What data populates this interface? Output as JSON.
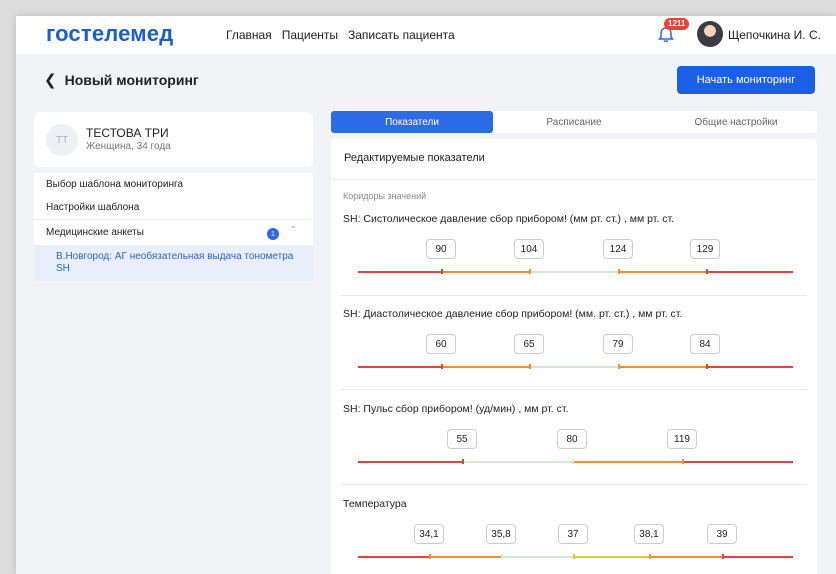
{
  "header": {
    "logo": "гостелемед",
    "nav": [
      "Главная",
      "Пациенты",
      "Записать пациента"
    ],
    "notification_count": "1211",
    "user_name": "Щепочкина И. С."
  },
  "page": {
    "title": "Новый мониторинг",
    "start_button": "Начать мониторинг"
  },
  "patient": {
    "initials": "ТТ",
    "name": "ТЕСТОВА ТРИ",
    "subtitle": "Женщина, 34 года"
  },
  "menu": {
    "items": [
      "Выбор шаблона мониторинга",
      "Настройки шаблона",
      "Медицинские анкеты"
    ],
    "questionnaire_count": "1",
    "selected_subitem": "В.Новгород: АГ необязательная выдача тонометра SH"
  },
  "tabs": [
    "Показатели",
    "Расписание",
    "Общие настройки"
  ],
  "content": {
    "title": "Редактируемые показатели",
    "corridors_label": "Коридоры значений",
    "indicators": [
      {
        "title": "SH: Систолическое давление сбор прибором! (мм рт. ст.) , мм рт. ст.",
        "thresholds": [
          "90",
          "104",
          "124",
          "129"
        ]
      },
      {
        "title": "SH: Диастолическое давление сбор прибором! (мм. рт. ст.) , мм рт. ст.",
        "thresholds": [
          "60",
          "65",
          "79",
          "84"
        ]
      },
      {
        "title": "SH: Пульс сбор прибором! (уд/мин) , мм рт. ст.",
        "thresholds": [
          "55",
          "80",
          "119"
        ]
      },
      {
        "title": "Температура",
        "thresholds": [
          "34,1",
          "35,8",
          "37",
          "38,1",
          "39"
        ]
      }
    ]
  },
  "colors": {
    "brand": "#1a5fcf",
    "accent": "#2d6be6",
    "danger": "#e8423a",
    "warning": "#f0922b",
    "caution": "#e8c53a",
    "normal": "#d6e8d2"
  }
}
